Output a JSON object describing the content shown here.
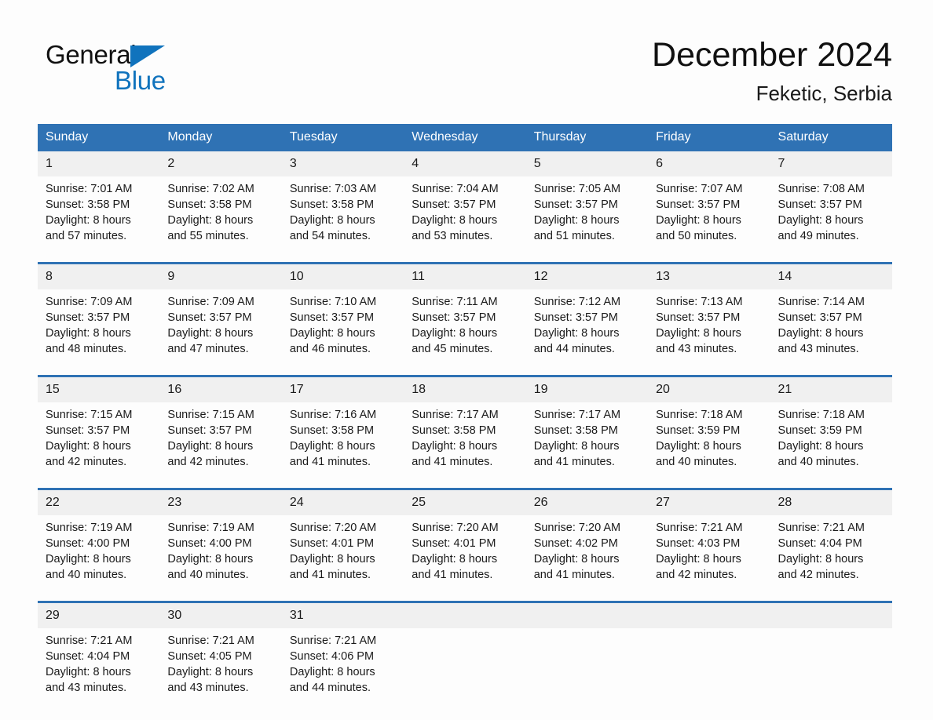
{
  "brand": {
    "name_part1": "General",
    "name_part2": "Blue",
    "triangle_icon": "brand-triangle-icon",
    "accent_color": "#1073bd"
  },
  "header": {
    "title": "December 2024",
    "subtitle": "Feketic, Serbia"
  },
  "colors": {
    "header_blue": "#2f72b4",
    "week_divider_blue": "#2f72b4",
    "daynum_band": "#f0f0f0",
    "page_background": "#fdfdfd",
    "text": "#1a1a1a"
  },
  "calendar": {
    "day_headers": [
      "Sunday",
      "Monday",
      "Tuesday",
      "Wednesday",
      "Thursday",
      "Friday",
      "Saturday"
    ],
    "weeks": [
      {
        "days": [
          {
            "date": "1",
            "sunrise": "Sunrise: 7:01 AM",
            "sunset": "Sunset: 3:58 PM",
            "daylight_1": "Daylight: 8 hours",
            "daylight_2": "and 57 minutes."
          },
          {
            "date": "2",
            "sunrise": "Sunrise: 7:02 AM",
            "sunset": "Sunset: 3:58 PM",
            "daylight_1": "Daylight: 8 hours",
            "daylight_2": "and 55 minutes."
          },
          {
            "date": "3",
            "sunrise": "Sunrise: 7:03 AM",
            "sunset": "Sunset: 3:58 PM",
            "daylight_1": "Daylight: 8 hours",
            "daylight_2": "and 54 minutes."
          },
          {
            "date": "4",
            "sunrise": "Sunrise: 7:04 AM",
            "sunset": "Sunset: 3:57 PM",
            "daylight_1": "Daylight: 8 hours",
            "daylight_2": "and 53 minutes."
          },
          {
            "date": "5",
            "sunrise": "Sunrise: 7:05 AM",
            "sunset": "Sunset: 3:57 PM",
            "daylight_1": "Daylight: 8 hours",
            "daylight_2": "and 51 minutes."
          },
          {
            "date": "6",
            "sunrise": "Sunrise: 7:07 AM",
            "sunset": "Sunset: 3:57 PM",
            "daylight_1": "Daylight: 8 hours",
            "daylight_2": "and 50 minutes."
          },
          {
            "date": "7",
            "sunrise": "Sunrise: 7:08 AM",
            "sunset": "Sunset: 3:57 PM",
            "daylight_1": "Daylight: 8 hours",
            "daylight_2": "and 49 minutes."
          }
        ]
      },
      {
        "days": [
          {
            "date": "8",
            "sunrise": "Sunrise: 7:09 AM",
            "sunset": "Sunset: 3:57 PM",
            "daylight_1": "Daylight: 8 hours",
            "daylight_2": "and 48 minutes."
          },
          {
            "date": "9",
            "sunrise": "Sunrise: 7:09 AM",
            "sunset": "Sunset: 3:57 PM",
            "daylight_1": "Daylight: 8 hours",
            "daylight_2": "and 47 minutes."
          },
          {
            "date": "10",
            "sunrise": "Sunrise: 7:10 AM",
            "sunset": "Sunset: 3:57 PM",
            "daylight_1": "Daylight: 8 hours",
            "daylight_2": "and 46 minutes."
          },
          {
            "date": "11",
            "sunrise": "Sunrise: 7:11 AM",
            "sunset": "Sunset: 3:57 PM",
            "daylight_1": "Daylight: 8 hours",
            "daylight_2": "and 45 minutes."
          },
          {
            "date": "12",
            "sunrise": "Sunrise: 7:12 AM",
            "sunset": "Sunset: 3:57 PM",
            "daylight_1": "Daylight: 8 hours",
            "daylight_2": "and 44 minutes."
          },
          {
            "date": "13",
            "sunrise": "Sunrise: 7:13 AM",
            "sunset": "Sunset: 3:57 PM",
            "daylight_1": "Daylight: 8 hours",
            "daylight_2": "and 43 minutes."
          },
          {
            "date": "14",
            "sunrise": "Sunrise: 7:14 AM",
            "sunset": "Sunset: 3:57 PM",
            "daylight_1": "Daylight: 8 hours",
            "daylight_2": "and 43 minutes."
          }
        ]
      },
      {
        "days": [
          {
            "date": "15",
            "sunrise": "Sunrise: 7:15 AM",
            "sunset": "Sunset: 3:57 PM",
            "daylight_1": "Daylight: 8 hours",
            "daylight_2": "and 42 minutes."
          },
          {
            "date": "16",
            "sunrise": "Sunrise: 7:15 AM",
            "sunset": "Sunset: 3:57 PM",
            "daylight_1": "Daylight: 8 hours",
            "daylight_2": "and 42 minutes."
          },
          {
            "date": "17",
            "sunrise": "Sunrise: 7:16 AM",
            "sunset": "Sunset: 3:58 PM",
            "daylight_1": "Daylight: 8 hours",
            "daylight_2": "and 41 minutes."
          },
          {
            "date": "18",
            "sunrise": "Sunrise: 7:17 AM",
            "sunset": "Sunset: 3:58 PM",
            "daylight_1": "Daylight: 8 hours",
            "daylight_2": "and 41 minutes."
          },
          {
            "date": "19",
            "sunrise": "Sunrise: 7:17 AM",
            "sunset": "Sunset: 3:58 PM",
            "daylight_1": "Daylight: 8 hours",
            "daylight_2": "and 41 minutes."
          },
          {
            "date": "20",
            "sunrise": "Sunrise: 7:18 AM",
            "sunset": "Sunset: 3:59 PM",
            "daylight_1": "Daylight: 8 hours",
            "daylight_2": "and 40 minutes."
          },
          {
            "date": "21",
            "sunrise": "Sunrise: 7:18 AM",
            "sunset": "Sunset: 3:59 PM",
            "daylight_1": "Daylight: 8 hours",
            "daylight_2": "and 40 minutes."
          }
        ]
      },
      {
        "days": [
          {
            "date": "22",
            "sunrise": "Sunrise: 7:19 AM",
            "sunset": "Sunset: 4:00 PM",
            "daylight_1": "Daylight: 8 hours",
            "daylight_2": "and 40 minutes."
          },
          {
            "date": "23",
            "sunrise": "Sunrise: 7:19 AM",
            "sunset": "Sunset: 4:00 PM",
            "daylight_1": "Daylight: 8 hours",
            "daylight_2": "and 40 minutes."
          },
          {
            "date": "24",
            "sunrise": "Sunrise: 7:20 AM",
            "sunset": "Sunset: 4:01 PM",
            "daylight_1": "Daylight: 8 hours",
            "daylight_2": "and 41 minutes."
          },
          {
            "date": "25",
            "sunrise": "Sunrise: 7:20 AM",
            "sunset": "Sunset: 4:01 PM",
            "daylight_1": "Daylight: 8 hours",
            "daylight_2": "and 41 minutes."
          },
          {
            "date": "26",
            "sunrise": "Sunrise: 7:20 AM",
            "sunset": "Sunset: 4:02 PM",
            "daylight_1": "Daylight: 8 hours",
            "daylight_2": "and 41 minutes."
          },
          {
            "date": "27",
            "sunrise": "Sunrise: 7:21 AM",
            "sunset": "Sunset: 4:03 PM",
            "daylight_1": "Daylight: 8 hours",
            "daylight_2": "and 42 minutes."
          },
          {
            "date": "28",
            "sunrise": "Sunrise: 7:21 AM",
            "sunset": "Sunset: 4:04 PM",
            "daylight_1": "Daylight: 8 hours",
            "daylight_2": "and 42 minutes."
          }
        ]
      },
      {
        "days": [
          {
            "date": "29",
            "sunrise": "Sunrise: 7:21 AM",
            "sunset": "Sunset: 4:04 PM",
            "daylight_1": "Daylight: 8 hours",
            "daylight_2": "and 43 minutes."
          },
          {
            "date": "30",
            "sunrise": "Sunrise: 7:21 AM",
            "sunset": "Sunset: 4:05 PM",
            "daylight_1": "Daylight: 8 hours",
            "daylight_2": "and 43 minutes."
          },
          {
            "date": "31",
            "sunrise": "Sunrise: 7:21 AM",
            "sunset": "Sunset: 4:06 PM",
            "daylight_1": "Daylight: 8 hours",
            "daylight_2": "and 44 minutes."
          },
          {
            "date": "",
            "sunrise": "",
            "sunset": "",
            "daylight_1": "",
            "daylight_2": ""
          },
          {
            "date": "",
            "sunrise": "",
            "sunset": "",
            "daylight_1": "",
            "daylight_2": ""
          },
          {
            "date": "",
            "sunrise": "",
            "sunset": "",
            "daylight_1": "",
            "daylight_2": ""
          },
          {
            "date": "",
            "sunrise": "",
            "sunset": "",
            "daylight_1": "",
            "daylight_2": ""
          }
        ]
      }
    ]
  }
}
